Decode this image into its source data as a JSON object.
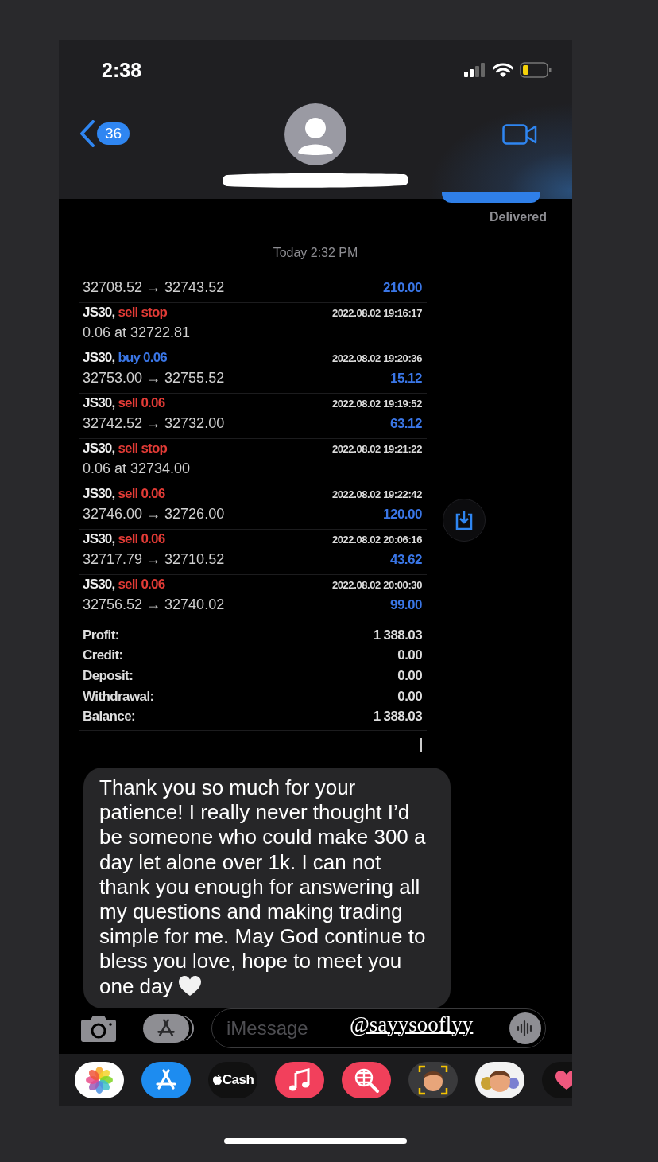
{
  "status_bar": {
    "time": "2:38"
  },
  "header": {
    "back_badge": "36"
  },
  "delivered": "Delivered",
  "timestamp": "Today 2:32 PM",
  "trades": [
    {
      "kind": "partial",
      "prices": "32708.52 → 32743.52",
      "profit": "210.00"
    },
    {
      "kind": "pending",
      "symbol": "JS30,",
      "color": "#e23b36",
      "action": "sell stop",
      "time": "2022.08.02 19:16:17",
      "prices": "0.06 at 32722.81"
    },
    {
      "kind": "closed",
      "symbol": "JS30,",
      "color": "#3a76e6",
      "action": "buy 0.06",
      "time": "2022.08.02 19:20:36",
      "prices": "32753.00 → 32755.52",
      "profit": "15.12"
    },
    {
      "kind": "closed",
      "symbol": "JS30,",
      "color": "#e23b36",
      "action": "sell 0.06",
      "time": "2022.08.02 19:19:52",
      "prices": "32742.52 → 32732.00",
      "profit": "63.12"
    },
    {
      "kind": "pending",
      "symbol": "JS30,",
      "color": "#e23b36",
      "action": "sell stop",
      "time": "2022.08.02 19:21:22",
      "prices": "0.06 at 32734.00"
    },
    {
      "kind": "closed",
      "symbol": "JS30,",
      "color": "#e23b36",
      "action": "sell 0.06",
      "time": "2022.08.02 19:22:42",
      "prices": "32746.00 → 32726.00",
      "profit": "120.00"
    },
    {
      "kind": "closed",
      "symbol": "JS30,",
      "color": "#e23b36",
      "action": "sell 0.06",
      "time": "2022.08.02 20:06:16",
      "prices": "32717.79 → 32710.52",
      "profit": "43.62"
    },
    {
      "kind": "closed",
      "symbol": "JS30,",
      "color": "#e23b36",
      "action": "sell 0.06",
      "time": "2022.08.02 20:00:30",
      "prices": "32756.52 → 32740.02",
      "profit": "99.00"
    }
  ],
  "summary": [
    {
      "label": "Profit:",
      "value": "1 388.03"
    },
    {
      "label": "Credit:",
      "value": "0.00"
    },
    {
      "label": "Deposit:",
      "value": "0.00"
    },
    {
      "label": "Withdrawal:",
      "value": "0.00"
    },
    {
      "label": "Balance:",
      "value": "1 388.03"
    }
  ],
  "message": "Thank you so much for your patience! I really never thought I’d be someone who could make 300 a day let alone over 1k. I can not thank you enough for answering all my questions and making trading simple for me. May God continue to bless you love, hope to meet you one day",
  "input": {
    "placeholder": "iMessage"
  },
  "mention": "@sayysooflyy",
  "dock": [
    {
      "kind": "photos"
    },
    {
      "kind": "app-store"
    },
    {
      "kind": "cash",
      "label": "Cash"
    },
    {
      "kind": "music"
    },
    {
      "kind": "search"
    },
    {
      "kind": "memoji"
    },
    {
      "kind": "stickers"
    },
    {
      "kind": "fitness"
    }
  ]
}
